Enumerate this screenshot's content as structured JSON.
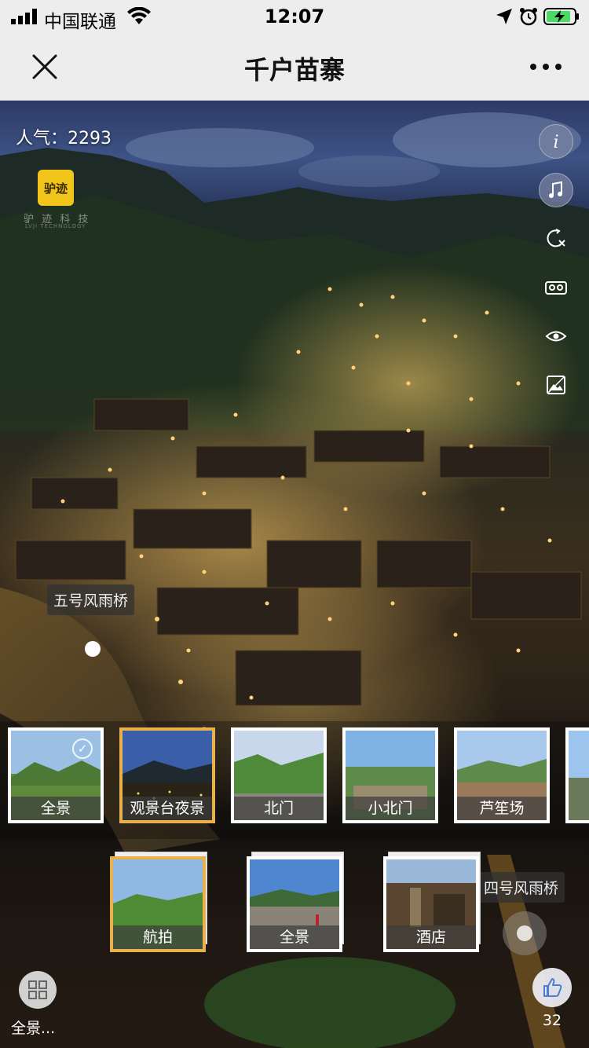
{
  "status_bar": {
    "carrier": "中国联通",
    "time": "12:07"
  },
  "nav": {
    "title": "千户苗寨"
  },
  "scene": {
    "popularity": "人气：2293",
    "logo_text": "驴迹",
    "logo_subtitle": "驴 迹 科 技",
    "logo_tagline": "LVJI TECHNOLOGY"
  },
  "side_tools": [
    {
      "icon": "info-icon",
      "name": "info-button"
    },
    {
      "icon": "music-icon",
      "name": "music-button"
    },
    {
      "icon": "gyro-icon",
      "name": "gyro-button"
    },
    {
      "icon": "vr-glasses-icon",
      "name": "vr-button"
    },
    {
      "icon": "eye-icon",
      "name": "view-mode-button"
    },
    {
      "icon": "gallery-icon",
      "name": "gallery-button"
    }
  ],
  "hotspots": {
    "left_label": "五号风雨桥",
    "right_label": "四号风雨桥"
  },
  "scenes": [
    {
      "label": "全景",
      "selected": true
    },
    {
      "label": "观景台夜景",
      "selected": false
    },
    {
      "label": "北门",
      "selected": false
    },
    {
      "label": "小北门",
      "selected": false
    },
    {
      "label": "芦笙场",
      "selected": false
    }
  ],
  "groups": [
    {
      "label": "航拍",
      "active": true
    },
    {
      "label": "全景",
      "active": false
    },
    {
      "label": "酒店",
      "active": false
    }
  ],
  "bottom": {
    "catalog_label": "全景...",
    "like_count": "32"
  },
  "colors": {
    "accent": "#e9b04c",
    "nav_bg": "#ededed",
    "logo_yellow": "#f2c51a"
  }
}
